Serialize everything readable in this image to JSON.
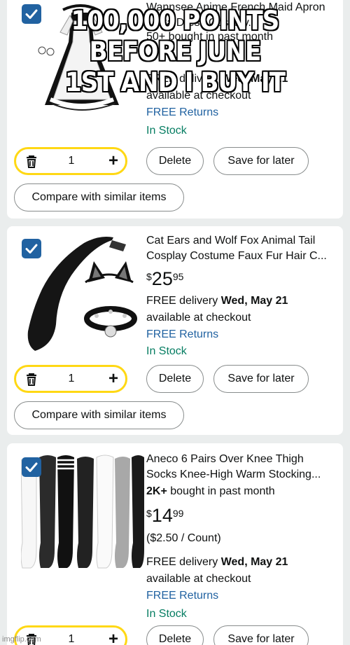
{
  "meme_caption": [
    "100,000 POINTS",
    "BEFORE JUNE",
    "1ST AND I BUY IT"
  ],
  "watermark": "imgflip.com",
  "colors": {
    "accent": "#2162a1",
    "in_stock": "#067d62",
    "qty_border": "#ffd814",
    "page_bg": "#eaeded"
  },
  "items": [
    {
      "title": "Wannsee Anime French Maid Apron Lolita Dress Cosplay...",
      "bought": "50+ bought in past month",
      "delivery_prefix": "FREE delivery",
      "delivery_date": "Wed, May 21",
      "availability": "available at checkout",
      "returns": "FREE Returns",
      "stock": "In Stock",
      "qty": "1",
      "delete_label": "Delete",
      "save_label": "Save for later",
      "compare_label": "Compare with similar items",
      "image_icon": "maid-dress-image"
    },
    {
      "title": "Cat Ears and Wolf Fox Animal Tail Cosplay Costume Faux Fur Hair C...",
      "price_currency": "$",
      "price_whole": "25",
      "price_fraction": "95",
      "delivery_prefix": "FREE delivery",
      "delivery_date": "Wed, May 21",
      "availability": "available at checkout",
      "returns": "FREE Returns",
      "stock": "In Stock",
      "qty": "1",
      "delete_label": "Delete",
      "save_label": "Save for later",
      "compare_label": "Compare with similar items",
      "image_icon": "cat-ears-tail-image"
    },
    {
      "title": "Aneco 6 Pairs Over Knee Thigh Socks Knee-High Warm Stocking...",
      "bought_bold": "2K+",
      "bought_rest": " bought in past month",
      "price_currency": "$",
      "price_whole": "14",
      "price_fraction": "99",
      "unit_price": "($2.50 / Count)",
      "delivery_prefix": "FREE delivery",
      "delivery_date": "Wed, May 21",
      "availability": "available at checkout",
      "returns": "FREE Returns",
      "stock": "In Stock",
      "qty": "1",
      "delete_label": "Delete",
      "save_label": "Save for later",
      "image_icon": "thigh-socks-image"
    }
  ]
}
